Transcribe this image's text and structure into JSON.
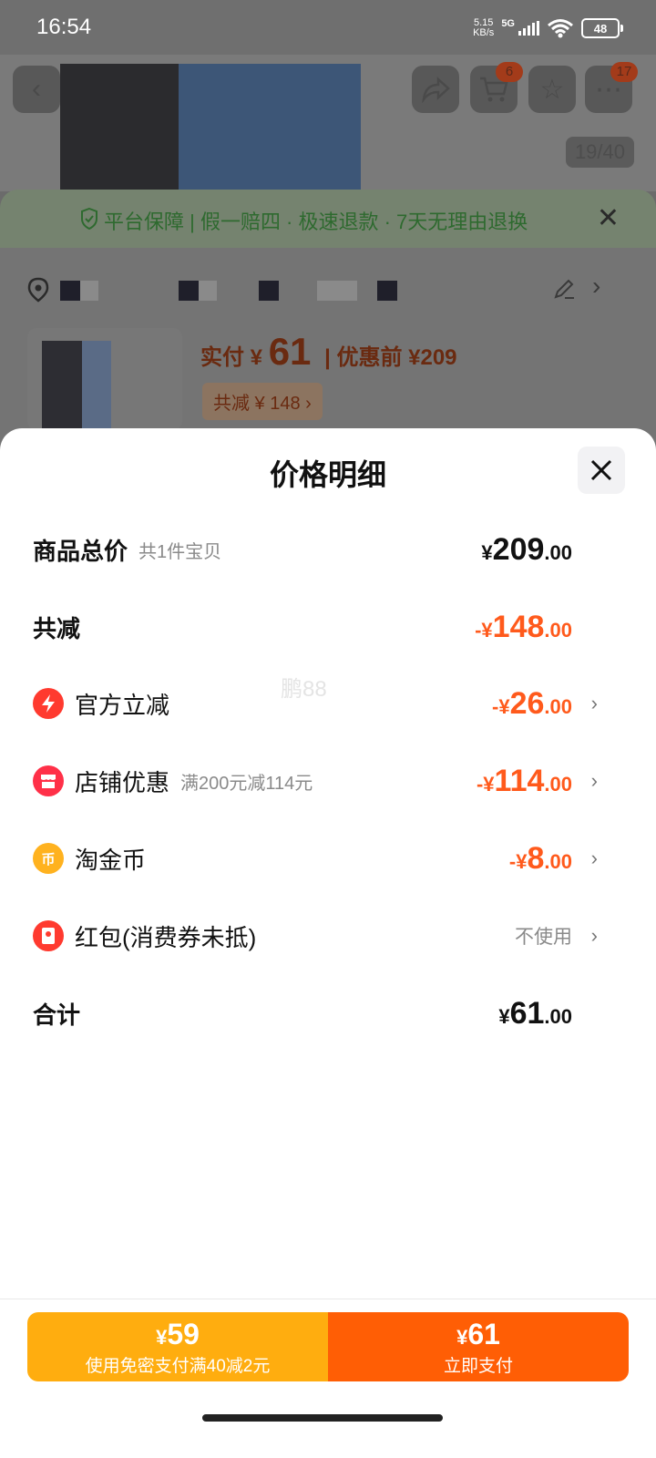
{
  "status_bar": {
    "time": "16:54",
    "speed_value": "5.15",
    "speed_unit": "KB/s",
    "network": "5G",
    "battery": "48"
  },
  "background": {
    "cart_badge": "6",
    "more_badge": "17",
    "image_counter": "19/40",
    "guarantee_text": "平台保障 | 假一赔四 · 极速退款 · 7天无理由退换",
    "paid_label": "实付 ¥",
    "paid_value": "61",
    "before_discount": "| 优惠前 ¥209",
    "total_discount_tag": "共减 ¥ 148 ›"
  },
  "sheet": {
    "title": "价格明细",
    "rows": [
      {
        "label": "商品总价",
        "sub": "共1件宝贝",
        "sign": "¥",
        "int": "209",
        "dec": ".00"
      },
      {
        "label": "共减",
        "sub": "",
        "sign": "-¥",
        "int": "148",
        "dec": ".00"
      },
      {
        "label": "官方立减",
        "sub": "",
        "sign": "-¥",
        "int": "26",
        "dec": ".00"
      },
      {
        "label": "店铺优惠",
        "sub": "满200元减114元",
        "sign": "-¥",
        "int": "114",
        "dec": ".00"
      },
      {
        "label": "淘金币",
        "sub": "",
        "sign": "-¥",
        "int": "8",
        "dec": ".00"
      },
      {
        "label": "红包(消费券未抵)",
        "sub": "",
        "value_text": "不使用"
      },
      {
        "label": "合计",
        "sub": "",
        "sign": "¥",
        "int": "61",
        "dec": ".00"
      }
    ],
    "watermark": "鹏88"
  },
  "pay": {
    "left_sign": "¥",
    "left_price": "59",
    "left_sub": "使用免密支付满40减2元",
    "right_sign": "¥",
    "right_price": "61",
    "right_sub": "立即支付"
  },
  "colors": {
    "accent_orange": "#ff5e05",
    "accent_yellow": "#ffad0f",
    "discount_text": "#ff5a1c"
  }
}
